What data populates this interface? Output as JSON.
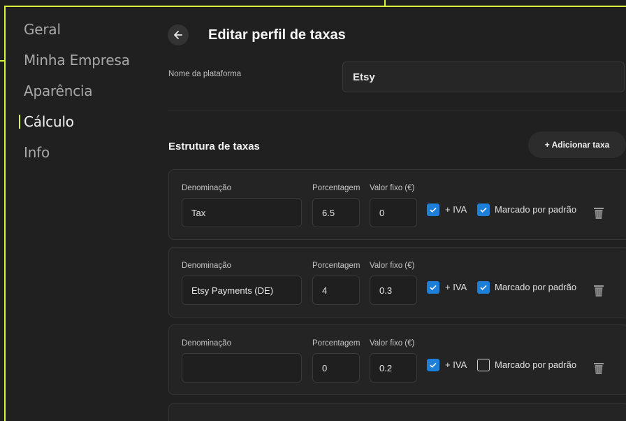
{
  "sidebar": {
    "items": [
      {
        "label": "Geral",
        "active": false
      },
      {
        "label": "Minha Empresa",
        "active": false
      },
      {
        "label": "Aparência",
        "active": false
      },
      {
        "label": "Cálculo",
        "active": true
      },
      {
        "label": "Info",
        "active": false
      }
    ]
  },
  "header": {
    "title": "Editar perfil de taxas",
    "back_icon": "arrow-left-icon"
  },
  "platform": {
    "label": "Nome da plataforma",
    "value": "Etsy"
  },
  "fees": {
    "title": "Estrutura de taxas",
    "add_label": "+ Adicionar taxa",
    "col_name": "Denominação",
    "col_percent": "Porcentagem",
    "col_fixed": "Valor fixo (€)",
    "vat_label": "+ IVA",
    "default_label": "Marcado por padrão",
    "rows": [
      {
        "name": "Tax",
        "percent": "6.5",
        "fixed": "0",
        "vat": true,
        "default": true
      },
      {
        "name": "Etsy Payments (DE)",
        "percent": "4",
        "fixed": "0.3",
        "vat": true,
        "default": true
      },
      {
        "name": "",
        "percent": "0",
        "fixed": "0.2",
        "vat": true,
        "default": false
      }
    ]
  },
  "colors": {
    "accent": "#d9f23a",
    "checkbox": "#1e7fd8",
    "background": "#202020"
  }
}
